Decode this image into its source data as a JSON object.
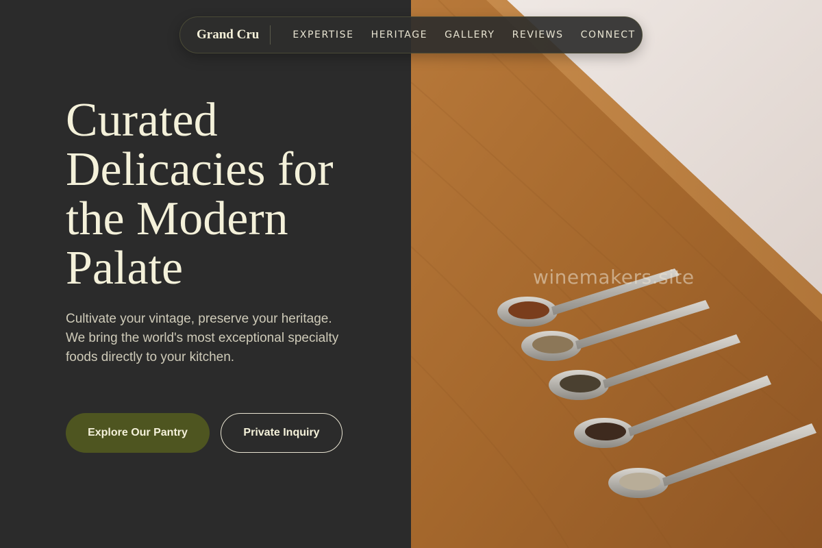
{
  "nav": {
    "brand": "Grand Cru",
    "links": [
      "EXPERTISE",
      "HERITAGE",
      "GALLERY",
      "REVIEWS",
      "CONNECT"
    ]
  },
  "hero": {
    "headline": "Curated Delicacies for the Modern Palate",
    "lead": "Cultivate your vintage, preserve your heritage. We bring the world's most exceptional specialty foods directly to your kitchen.",
    "primary_cta": "Explore Our Pantry",
    "secondary_cta": "Private Inquiry"
  },
  "watermark": "winemakers.site",
  "colors": {
    "background": "#2b2b2b",
    "accent_olive": "#4e5520",
    "cream_text": "#f4f1da",
    "wood": "#a76a2e"
  }
}
